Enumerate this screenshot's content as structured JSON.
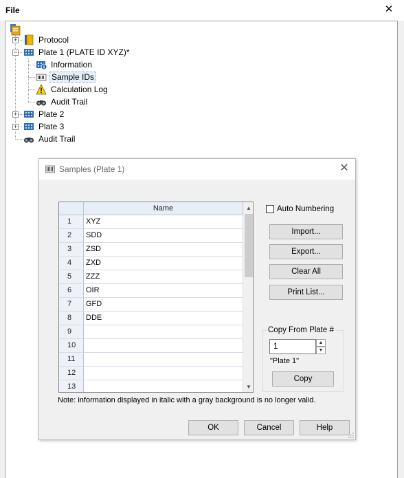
{
  "panel": {
    "title": "File",
    "close_glyph": "✕"
  },
  "tree": {
    "items": [
      {
        "label": "Protocol",
        "icon": "protocol-icon"
      },
      {
        "label": "Plate 1 (PLATE ID XYZ)*",
        "icon": "plate-icon"
      },
      {
        "label": "Information",
        "icon": "information-icon"
      },
      {
        "label": "Sample IDs",
        "icon": "sample-ids-icon"
      },
      {
        "label": "Calculation Log",
        "icon": "warning-icon"
      },
      {
        "label": "Audit Trail",
        "icon": "binoculars-icon"
      },
      {
        "label": "Plate 2",
        "icon": "plate-icon"
      },
      {
        "label": "Plate 3",
        "icon": "plate-icon"
      },
      {
        "label": "Audit Trail",
        "icon": "binoculars-icon"
      }
    ]
  },
  "dialog": {
    "title": "Samples (Plate 1)",
    "close_glyph": "✕",
    "grid": {
      "column_header": "Name",
      "rows": [
        {
          "num": "1",
          "value": "XYZ"
        },
        {
          "num": "2",
          "value": "SDD"
        },
        {
          "num": "3",
          "value": "ZSD"
        },
        {
          "num": "4",
          "value": "ZXD"
        },
        {
          "num": "5",
          "value": "ZZZ"
        },
        {
          "num": "6",
          "value": "OIR"
        },
        {
          "num": "7",
          "value": "GFD"
        },
        {
          "num": "8",
          "value": "DDE"
        },
        {
          "num": "9",
          "value": ""
        },
        {
          "num": "10",
          "value": ""
        },
        {
          "num": "11",
          "value": ""
        },
        {
          "num": "12",
          "value": ""
        },
        {
          "num": "13",
          "value": ""
        }
      ]
    },
    "auto_numbering_label": "Auto Numbering",
    "auto_numbering_checked": false,
    "buttons": {
      "import": "Import...",
      "export": "Export...",
      "clear_all": "Clear All",
      "print_list": "Print List...",
      "copy": "Copy",
      "ok": "OK",
      "cancel": "Cancel",
      "help": "Help"
    },
    "copy_from": {
      "label": "Copy From Plate #",
      "value": "1",
      "caption": "\"Plate 1\""
    },
    "note": "Note: information displayed in italic with a gray background is no longer valid.",
    "colors": {
      "header_bg": "#e8eef7",
      "selected_bg": "#e5f0fb",
      "button_bg": "#e1e1e1"
    }
  }
}
